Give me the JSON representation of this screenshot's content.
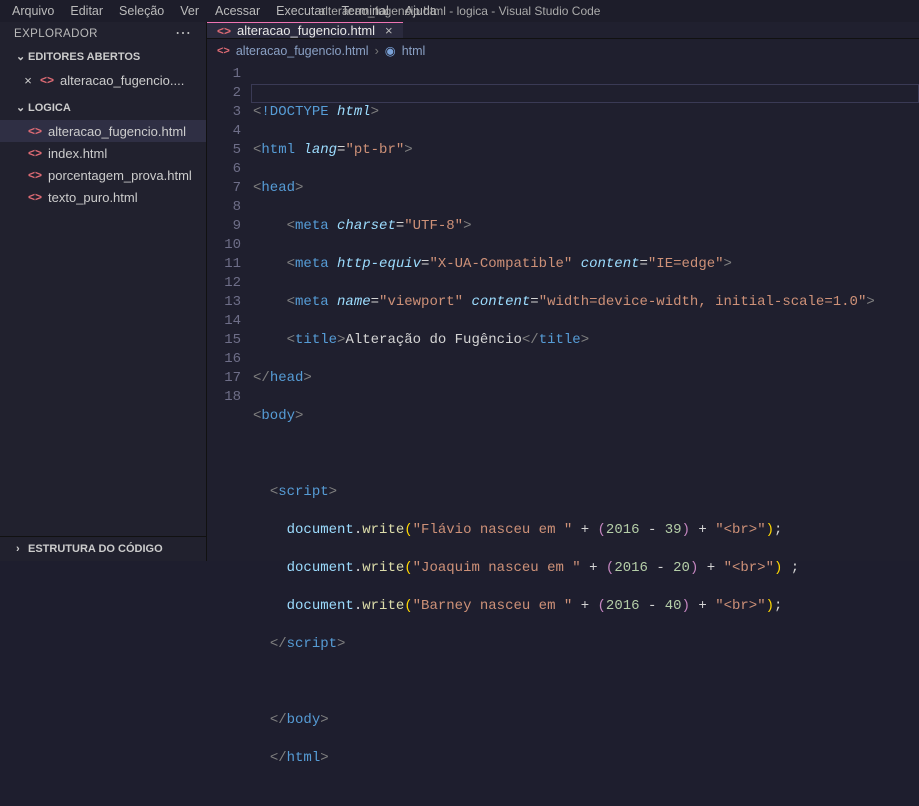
{
  "window": {
    "title": "alteracao_fugencio.html - logica - Visual Studio Code"
  },
  "menu": {
    "arquivo": "Arquivo",
    "editar": "Editar",
    "selecao": "Seleção",
    "ver": "Ver",
    "acessar": "Acessar",
    "executar": "Executar",
    "terminal": "Terminal",
    "ajuda": "Ajuda"
  },
  "sidebar": {
    "title": "EXPLORADOR",
    "openEditors": "EDITORES ABERTOS",
    "folder": "LOGICA",
    "outline": "ESTRUTURA DO CÓDIGO",
    "openFile": "alteracao_fugencio....",
    "files": {
      "f0": "alteracao_fugencio.html",
      "f1": "index.html",
      "f2": "porcentagem_prova.html",
      "f3": "texto_puro.html"
    }
  },
  "tab": {
    "name": "alteracao_fugencio.html",
    "crumbName": "alteracao_fugencio.html",
    "crumbNode": "html"
  },
  "code": {
    "lineNumbers": [
      "1",
      "2",
      "3",
      "4",
      "5",
      "6",
      "7",
      "8",
      "9",
      "10",
      "11",
      "12",
      "13",
      "14",
      "15",
      "16",
      "17",
      "18"
    ],
    "l1": {
      "doctype": "!DOCTYPE",
      "html": "html"
    },
    "l2": {
      "tag": "html",
      "attr": "lang",
      "val": "\"pt-br\""
    },
    "l3": {
      "tag": "head"
    },
    "l4": {
      "tag": "meta",
      "a1": "charset",
      "v1": "\"UTF-8\""
    },
    "l5": {
      "tag": "meta",
      "a1": "http-equiv",
      "v1": "\"X-UA-Compatible\"",
      "a2": "content",
      "v2": "\"IE=edge\""
    },
    "l6": {
      "tag": "meta",
      "a1": "name",
      "v1": "\"viewport\"",
      "a2": "content",
      "v2": "\"width=device-width, initial-scale=1.0\""
    },
    "l7": {
      "tag": "title",
      "text": "Alteração do Fugêncio",
      "close": "title"
    },
    "l8": {
      "close": "head"
    },
    "l9": {
      "tag": "body"
    },
    "l11": {
      "tag": "script"
    },
    "l12": {
      "obj": "document",
      "func": "write",
      "s": "\"Flávio nasceu em \"",
      "ny": "2016",
      "nb": "39",
      "tail": "\"<br>\""
    },
    "l13": {
      "obj": "document",
      "func": "write",
      "s": "\"Joaquim nasceu em \"",
      "ny": "2016",
      "nb": "20",
      "tail": "\"<br>\"",
      "semispace": " ;"
    },
    "l14": {
      "obj": "document",
      "func": "write",
      "s": "\"Barney nasceu em \"",
      "ny": "2016",
      "nb": "40",
      "tail": "\"<br>\""
    },
    "l15": {
      "close": "script"
    },
    "l17": {
      "close": "body"
    },
    "l18": {
      "close": "html"
    }
  }
}
